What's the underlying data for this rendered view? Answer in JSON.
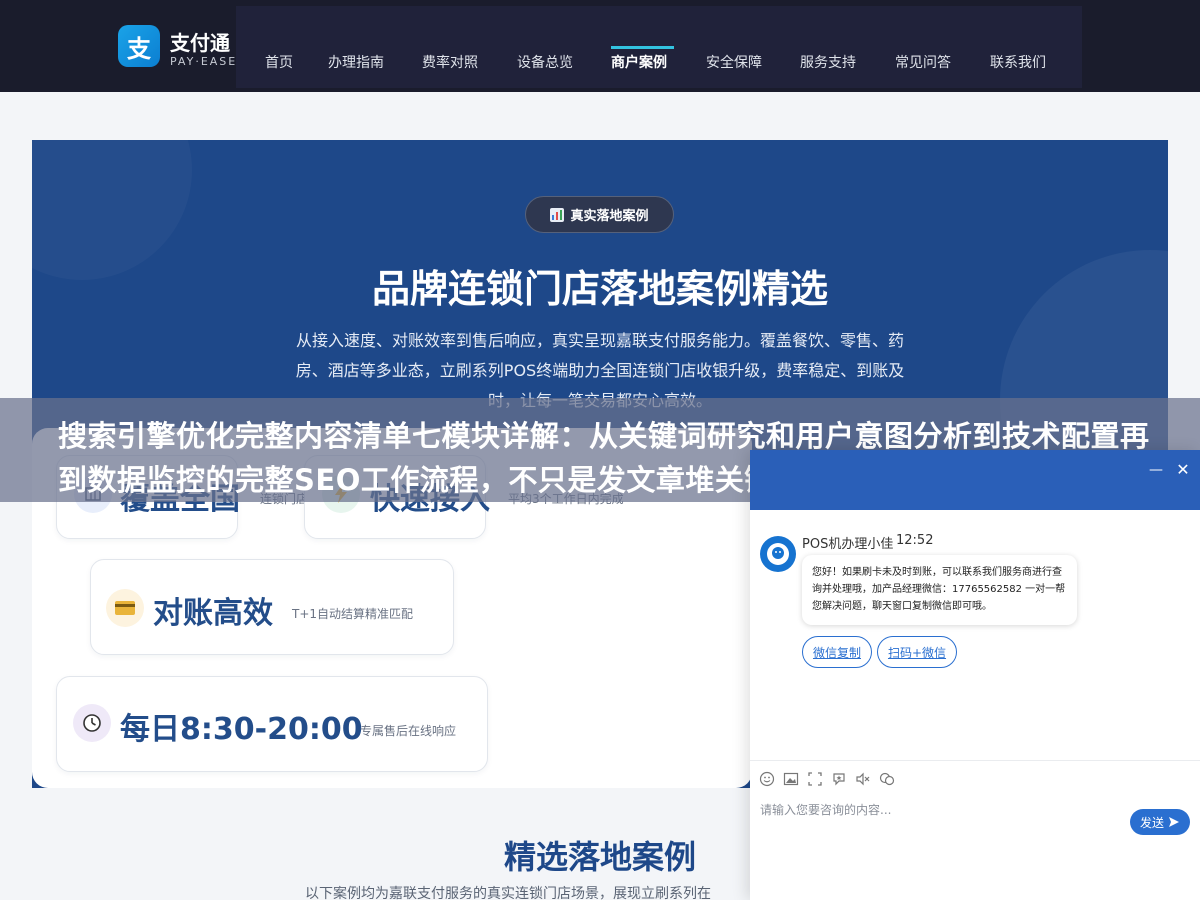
{
  "brand": {
    "icon_char": "支",
    "name": "支付通",
    "sub": "PAY·EASE"
  },
  "nav": {
    "items": [
      "首页",
      "办理指南",
      "费率对照",
      "设备总览",
      "商户案例",
      "安全保障",
      "服务支持",
      "常见问答",
      "联系我们"
    ],
    "active_index": 4
  },
  "hero": {
    "badge_icon": "bar-chart-icon",
    "badge": "真实落地案例",
    "title": "品牌连锁门店落地案例精选",
    "desc": "从接入速度、对账效率到售后响应，真实呈现嘉联支付服务能力。覆盖餐饮、零售、药房、酒店等多业态，立刷系列POS终端助力全国连锁门店收银升级，费率稳定、到账及时，让每一笔交易都安心高效。"
  },
  "stats": [
    {
      "icon": "map-icon",
      "value": "覆盖全国",
      "note": "连锁门店"
    },
    {
      "icon": "lightning-icon",
      "value": "快速接入",
      "note": "平均3个工作日内完成"
    },
    {
      "icon": "card-icon",
      "value": "对账高效",
      "note": "T+1自动结算精准匹配"
    },
    {
      "icon": "clock-icon",
      "value": "每日8:30-20:00",
      "note": "专属售后在线响应"
    }
  ],
  "section": {
    "title": "精选落地案例",
    "sub": "以下案例均为嘉联支付服务的真实连锁门店场景，展现立刷系列在"
  },
  "overlay": {
    "text": "搜索引擎优化完整内容清单七模块详解：从关键词研究和用户意图分析到技术配置再到数据监控的完整SEO工作流程，不只是发文章堆关键词那么"
  },
  "chat": {
    "minimize": "—",
    "close": "✕",
    "agent_name": "POS机办理小佳",
    "time": "12:52",
    "message": "您好！如果刷卡未及时到账，可以联系我们服务商进行查询并处理哦，加产品经理微信：17765562582 一对一帮您解决问题，聊天窗口复制微信即可哦。",
    "buttons": [
      "微信复制",
      "扫码+微信"
    ],
    "toolbar": [
      "emoji-icon",
      "image-icon",
      "screenshot-icon",
      "evaluate-icon",
      "voice-icon",
      "chat-icon"
    ],
    "input_placeholder": "请输入您要咨询的内容...",
    "send_label": "发送"
  },
  "colors": {
    "header_bg": "#1a1c2c",
    "hero_bg": "#1e4889",
    "accent": "#2a6fd0",
    "stat_value": "#234d8a"
  }
}
